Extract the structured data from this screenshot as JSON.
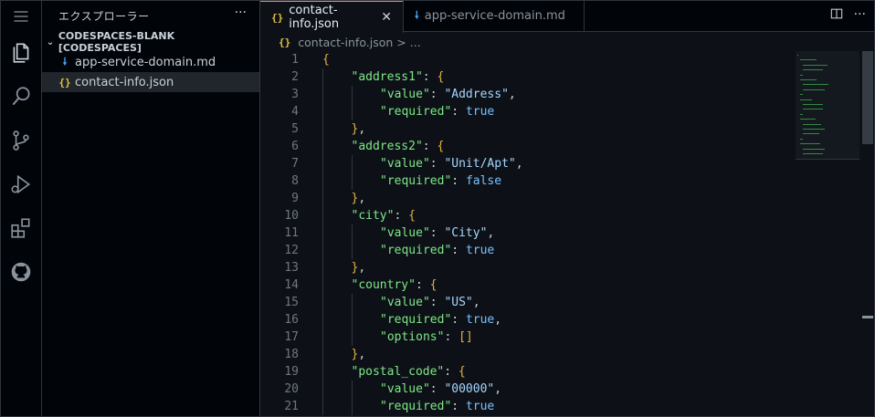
{
  "sidebar": {
    "title": "エクスプローラー",
    "more": "···",
    "folder": "CODESPACES-BLANK [CODESPACES]",
    "files": [
      {
        "name": "app-service-domain.md",
        "icon": "markdown-icon",
        "active": false
      },
      {
        "name": "contact-info.json",
        "icon": "json-icon",
        "active": true
      }
    ]
  },
  "tabs": [
    {
      "label": "contact-info.json",
      "icon": "json-icon",
      "active": true,
      "close": "✕"
    },
    {
      "label": "app-service-domain.md",
      "icon": "markdown-icon",
      "active": false
    }
  ],
  "breadcrumb": {
    "file": "contact-info.json",
    "separator": ">",
    "rest": "..."
  },
  "colors": {
    "background": "#0d1117",
    "key": "#7ee787",
    "string": "#a5d6ff",
    "boolean": "#79c0ff",
    "bracket": "#e3b341",
    "json_icon": "#e3c341",
    "markdown_icon": "#42a5f5"
  },
  "code_lines": [
    {
      "n": "1",
      "indent": 0,
      "tokens": [
        [
          "brk",
          "{"
        ]
      ]
    },
    {
      "n": "2",
      "indent": 1,
      "tokens": [
        [
          "k",
          "\"address1\""
        ],
        [
          "p",
          ": "
        ],
        [
          "brk",
          "{"
        ]
      ]
    },
    {
      "n": "3",
      "indent": 2,
      "tokens": [
        [
          "k",
          "\"value\""
        ],
        [
          "p",
          ": "
        ],
        [
          "s",
          "\"Address\""
        ],
        [
          "p",
          ","
        ]
      ]
    },
    {
      "n": "4",
      "indent": 2,
      "tokens": [
        [
          "k",
          "\"required\""
        ],
        [
          "p",
          ": "
        ],
        [
          "b",
          "true"
        ]
      ]
    },
    {
      "n": "5",
      "indent": 1,
      "tokens": [
        [
          "brk",
          "}"
        ],
        [
          "p",
          ","
        ]
      ]
    },
    {
      "n": "6",
      "indent": 1,
      "tokens": [
        [
          "k",
          "\"address2\""
        ],
        [
          "p",
          ": "
        ],
        [
          "brk",
          "{"
        ]
      ]
    },
    {
      "n": "7",
      "indent": 2,
      "tokens": [
        [
          "k",
          "\"value\""
        ],
        [
          "p",
          ": "
        ],
        [
          "s",
          "\"Unit/Apt\""
        ],
        [
          "p",
          ","
        ]
      ]
    },
    {
      "n": "8",
      "indent": 2,
      "tokens": [
        [
          "k",
          "\"required\""
        ],
        [
          "p",
          ": "
        ],
        [
          "b",
          "false"
        ]
      ]
    },
    {
      "n": "9",
      "indent": 1,
      "tokens": [
        [
          "brk",
          "}"
        ],
        [
          "p",
          ","
        ]
      ]
    },
    {
      "n": "10",
      "indent": 1,
      "tokens": [
        [
          "k",
          "\"city\""
        ],
        [
          "p",
          ": "
        ],
        [
          "brk",
          "{"
        ]
      ]
    },
    {
      "n": "11",
      "indent": 2,
      "tokens": [
        [
          "k",
          "\"value\""
        ],
        [
          "p",
          ": "
        ],
        [
          "s",
          "\"City\""
        ],
        [
          "p",
          ","
        ]
      ]
    },
    {
      "n": "12",
      "indent": 2,
      "tokens": [
        [
          "k",
          "\"required\""
        ],
        [
          "p",
          ": "
        ],
        [
          "b",
          "true"
        ]
      ]
    },
    {
      "n": "13",
      "indent": 1,
      "tokens": [
        [
          "brk",
          "}"
        ],
        [
          "p",
          ","
        ]
      ]
    },
    {
      "n": "14",
      "indent": 1,
      "tokens": [
        [
          "k",
          "\"country\""
        ],
        [
          "p",
          ": "
        ],
        [
          "brk",
          "{"
        ]
      ]
    },
    {
      "n": "15",
      "indent": 2,
      "tokens": [
        [
          "k",
          "\"value\""
        ],
        [
          "p",
          ": "
        ],
        [
          "s",
          "\"US\""
        ],
        [
          "p",
          ","
        ]
      ]
    },
    {
      "n": "16",
      "indent": 2,
      "tokens": [
        [
          "k",
          "\"required\""
        ],
        [
          "p",
          ": "
        ],
        [
          "b",
          "true"
        ],
        [
          "p",
          ","
        ]
      ]
    },
    {
      "n": "17",
      "indent": 2,
      "tokens": [
        [
          "k",
          "\"options\""
        ],
        [
          "p",
          ": "
        ],
        [
          "brk",
          "[]"
        ]
      ]
    },
    {
      "n": "18",
      "indent": 1,
      "tokens": [
        [
          "brk",
          "}"
        ],
        [
          "p",
          ","
        ]
      ]
    },
    {
      "n": "19",
      "indent": 1,
      "tokens": [
        [
          "k",
          "\"postal_code\""
        ],
        [
          "p",
          ": "
        ],
        [
          "brk",
          "{"
        ]
      ]
    },
    {
      "n": "20",
      "indent": 2,
      "tokens": [
        [
          "k",
          "\"value\""
        ],
        [
          "p",
          ": "
        ],
        [
          "s",
          "\"00000\""
        ],
        [
          "p",
          ","
        ]
      ]
    },
    {
      "n": "21",
      "indent": 2,
      "tokens": [
        [
          "k",
          "\"required\""
        ],
        [
          "p",
          ": "
        ],
        [
          "b",
          "true"
        ]
      ]
    }
  ]
}
